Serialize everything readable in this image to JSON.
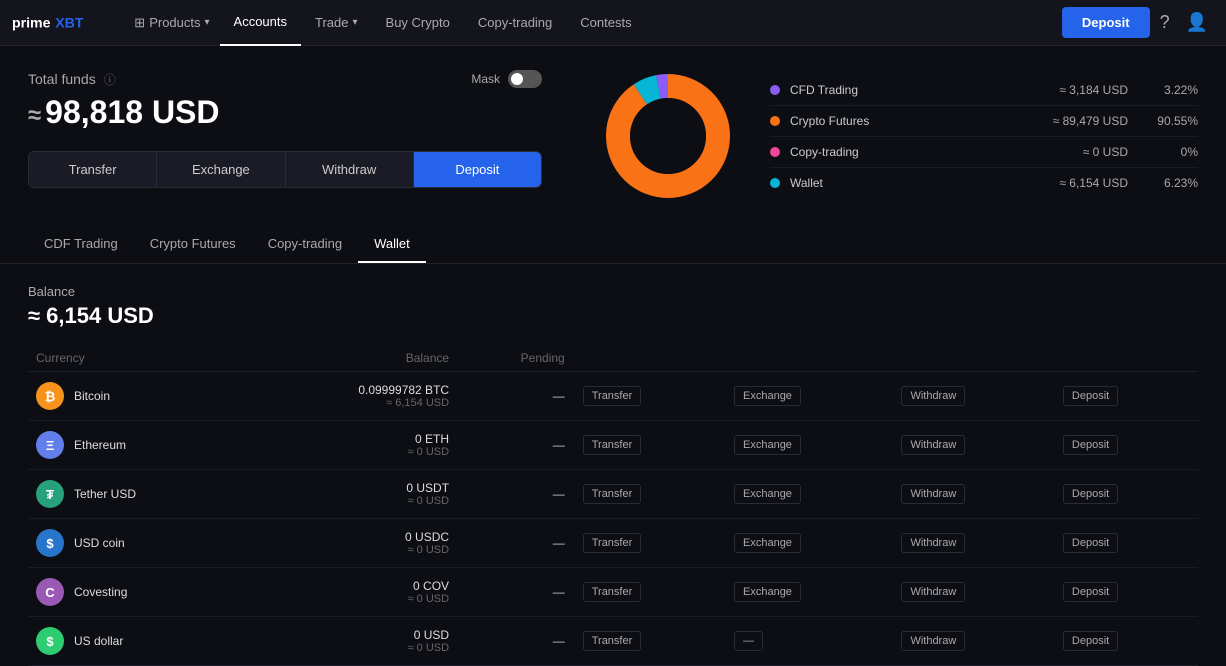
{
  "navbar": {
    "logo_text": "prime XBT",
    "products_label": "Products",
    "nav_items": [
      {
        "label": "Accounts",
        "active": true
      },
      {
        "label": "Trade",
        "active": false
      },
      {
        "label": "Buy Crypto",
        "active": false
      },
      {
        "label": "Copy-trading",
        "active": false
      },
      {
        "label": "Contests",
        "active": false
      }
    ],
    "deposit_label": "Deposit",
    "help_icon": "?",
    "user_icon": "👤"
  },
  "left_panel": {
    "total_funds_label": "Total funds",
    "mask_label": "Mask",
    "total_amount": "98,818 USD",
    "approx_symbol": "≈",
    "action_buttons": [
      {
        "label": "Transfer",
        "active": false
      },
      {
        "label": "Exchange",
        "active": false
      },
      {
        "label": "Withdraw",
        "active": false
      },
      {
        "label": "Deposit",
        "active": true
      }
    ]
  },
  "tabs": [
    {
      "label": "CDF Trading",
      "active": false
    },
    {
      "label": "Crypto Futures",
      "active": false
    },
    {
      "label": "Copy-trading",
      "active": false
    },
    {
      "label": "Wallet",
      "active": true
    }
  ],
  "balance_section": {
    "label": "Balance",
    "amount": "≈ 6,154 USD"
  },
  "table": {
    "headers": [
      "Currency",
      "Balance",
      "Pending",
      "",
      "",
      "",
      ""
    ],
    "rows": [
      {
        "coin_class": "coin-btc",
        "coin_letter": "₿",
        "name": "Bitcoin",
        "bal_main": "0.09999782 BTC",
        "bal_sub": "≈ 6,154 USD",
        "pending": "—",
        "actions": [
          "Transfer",
          "Exchange",
          "Withdraw",
          "Deposit"
        ]
      },
      {
        "coin_class": "coin-eth",
        "coin_letter": "Ξ",
        "name": "Ethereum",
        "bal_main": "0 ETH",
        "bal_sub": "≈ 0 USD",
        "pending": "—",
        "actions": [
          "Transfer",
          "Exchange",
          "Withdraw",
          "Deposit"
        ]
      },
      {
        "coin_class": "coin-usdt",
        "coin_letter": "₮",
        "name": "Tether USD",
        "bal_main": "0 USDT",
        "bal_sub": "≈ 0 USD",
        "pending": "—",
        "actions": [
          "Transfer",
          "Exchange",
          "Withdraw",
          "Deposit"
        ]
      },
      {
        "coin_class": "coin-usdc",
        "coin_letter": "$",
        "name": "USD coin",
        "bal_main": "0 USDC",
        "bal_sub": "≈ 0 USD",
        "pending": "—",
        "actions": [
          "Transfer",
          "Exchange",
          "Withdraw",
          "Deposit"
        ]
      },
      {
        "coin_class": "coin-cov",
        "coin_letter": "C",
        "name": "Covesting",
        "bal_main": "0 COV",
        "bal_sub": "≈ 0 USD",
        "pending": "—",
        "actions": [
          "Transfer",
          "Exchange",
          "Withdraw",
          "Deposit"
        ]
      },
      {
        "coin_class": "coin-usd",
        "coin_letter": "$",
        "name": "US dollar",
        "bal_main": "0 USD",
        "bal_sub": "≈ 0 USD",
        "pending": "—",
        "actions": [
          "Transfer",
          "—",
          "Withdraw",
          "Deposit"
        ]
      }
    ]
  },
  "chart": {
    "legend": [
      {
        "label": "CFD Trading",
        "color": "#8b5cf6",
        "value": "≈ 3,184 USD",
        "pct": "3.22%"
      },
      {
        "label": "Crypto Futures",
        "color": "#f97316",
        "value": "≈ 89,479 USD",
        "pct": "90.55%"
      },
      {
        "label": "Copy-trading",
        "color": "#ec4899",
        "value": "≈ 0 USD",
        "pct": "0%"
      },
      {
        "label": "Wallet",
        "color": "#06b6d4",
        "value": "≈ 6,154 USD",
        "pct": "6.23%"
      }
    ],
    "segments": [
      {
        "color": "#8b5cf6",
        "pct": 3.22
      },
      {
        "color": "#f97316",
        "pct": 90.55
      },
      {
        "color": "#ec4899",
        "pct": 0
      },
      {
        "color": "#06b6d4",
        "pct": 6.23
      }
    ]
  }
}
